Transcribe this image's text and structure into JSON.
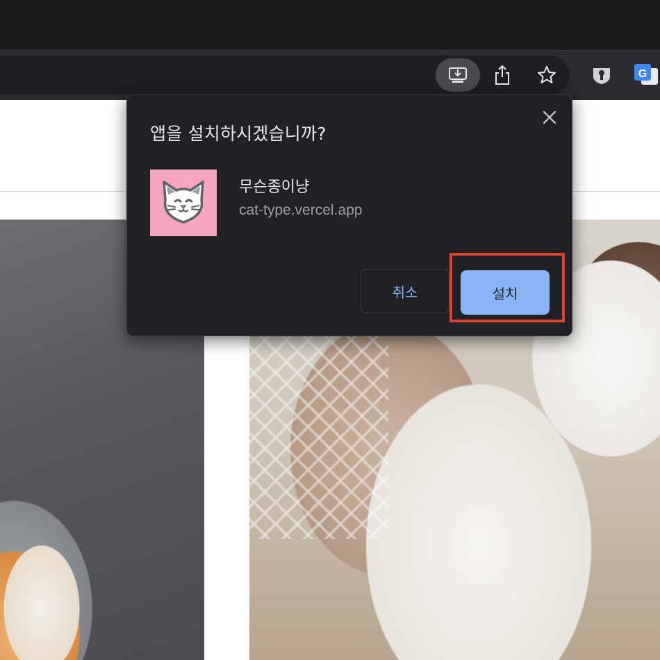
{
  "browser": {
    "toolbar_buttons": [
      {
        "icon": "install-app-icon",
        "active": true
      },
      {
        "icon": "share-icon",
        "active": false
      },
      {
        "icon": "bookmark-star-icon",
        "active": false
      }
    ],
    "extensions": [
      {
        "icon": "password-manager-icon"
      },
      {
        "icon": "google-translate-icon",
        "label": "G"
      }
    ]
  },
  "dialog": {
    "title": "앱을 설치하시겠습니까?",
    "app_name": "무슨종이냥",
    "app_url": "cat-type.vercel.app",
    "cancel_label": "취소",
    "install_label": "설치",
    "close_icon": "close-icon",
    "app_icon": "cat-face-icon",
    "accent_color": "#8ab4f8",
    "highlight_color": "#e0412c"
  },
  "page": {
    "images": [
      {
        "name": "cat-with-cone-photo"
      },
      {
        "name": "ragdoll-cat-photo"
      }
    ]
  }
}
